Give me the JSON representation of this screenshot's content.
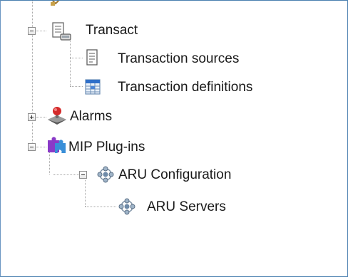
{
  "tree": {
    "nodes": [
      {
        "label": "Transact",
        "icon": "transact-icon",
        "expanded": true
      },
      {
        "label": "Transaction sources",
        "icon": "document-list-icon"
      },
      {
        "label": "Transaction definitions",
        "icon": "spreadsheet-icon"
      },
      {
        "label": "Alarms",
        "icon": "alarm-icon",
        "expanded": false
      },
      {
        "label": "MIP Plug-ins",
        "icon": "puzzle-icon",
        "expanded": true
      },
      {
        "label": "ARU Configuration",
        "icon": "network-icon",
        "expanded": true
      },
      {
        "label": "ARU Servers",
        "icon": "network-icon"
      }
    ]
  },
  "colors": {
    "border": "#4a7fb0",
    "connector": "#a8a8a8",
    "alarm_red": "#d42a2a",
    "puzzle_blue": "#3a8fd8",
    "puzzle_purple": "#8a3ac8",
    "spreadsheet_blue": "#2f6fc9"
  }
}
